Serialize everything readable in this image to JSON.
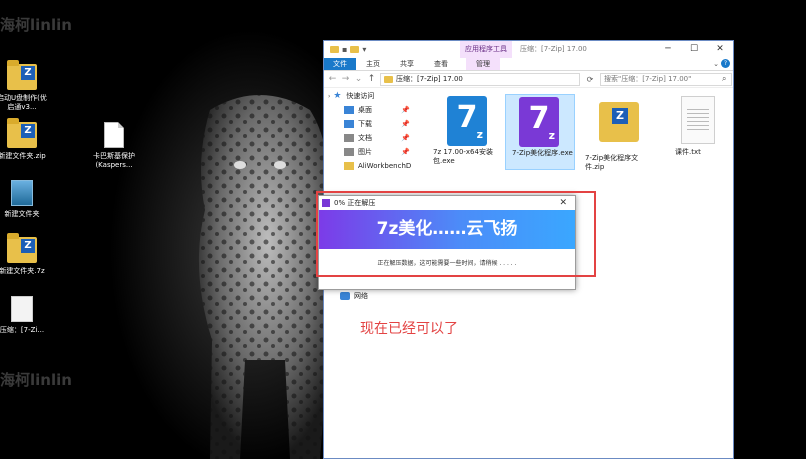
{
  "desktop": {
    "watermark_top": "海柯linlin",
    "watermark_bottom": "海柯linlin",
    "icons": [
      {
        "label": "启动U盘制作(优启通v3...",
        "icon": "7zip-folder-icon"
      },
      {
        "label": "新建文件夹.zip",
        "icon": "7zip-folder-icon"
      },
      {
        "label": "卡巴斯基保护(Kaspers...",
        "icon": "document-icon"
      },
      {
        "label": "新建文件夹",
        "icon": "installer-icon"
      },
      {
        "label": "新建文件夹.7z",
        "icon": "7zip-folder-icon"
      },
      {
        "label": "压缩：[7-Zi...",
        "icon": "file-icon"
      }
    ]
  },
  "explorer": {
    "title": "压缩：[7-Zip] 17.00",
    "context_tab_title": "应用程序工具",
    "window_buttons": {
      "minimize": "─",
      "maximize": "☐",
      "close": "✕"
    },
    "ribbon_tabs": [
      "文件",
      "主页",
      "共享",
      "查看",
      "管理"
    ],
    "collapse_glyph": "⌄",
    "help_glyph": "?",
    "nav_buttons": {
      "back": "←",
      "forward": "→",
      "recent": "⌄",
      "up": "↑"
    },
    "address_path": "压缩：[7-Zip] 17.00",
    "refresh_glyph": "⟳",
    "search_placeholder": "搜索\"压缩：[7-Zip] 17.00\"",
    "nav_items": [
      {
        "label": "快速访问",
        "icon": "star-icon",
        "pinned": false
      },
      {
        "label": "桌面",
        "icon": "desktop-icon",
        "pinned": true
      },
      {
        "label": "下载",
        "icon": "download-icon",
        "pinned": true
      },
      {
        "label": "文档",
        "icon": "document-icon",
        "pinned": true
      },
      {
        "label": "图片",
        "icon": "picture-icon",
        "pinned": true
      },
      {
        "label": "AliWorkbenchD",
        "icon": "folder-icon",
        "pinned": false
      }
    ],
    "network_label": "网络",
    "pin_glyph": "📌",
    "files": [
      {
        "name": "7z 17.00-x64安装包.exe",
        "icon_letter": "7",
        "icon_sub": "z"
      },
      {
        "name": "7-Zip美化程序.exe",
        "icon_letter": "7",
        "icon_sub": "z",
        "selected": true
      },
      {
        "name": "7-Zip美化程序文件.zip",
        "icon_letter": "Z"
      },
      {
        "name": "课件.txt"
      }
    ]
  },
  "dialog": {
    "title": "0% 正在解压",
    "close_glyph": "✕",
    "banner": "7z美化……云飞扬",
    "message": "正在解压数据，这可能需要一些时间，请稍候 . . . . ."
  },
  "annotation": "现在已经可以了",
  "colors": {
    "accent": "#1979ca",
    "annotation_red": "#e34343",
    "banner_start": "#7c3be8",
    "banner_end": "#3aa7ff"
  }
}
